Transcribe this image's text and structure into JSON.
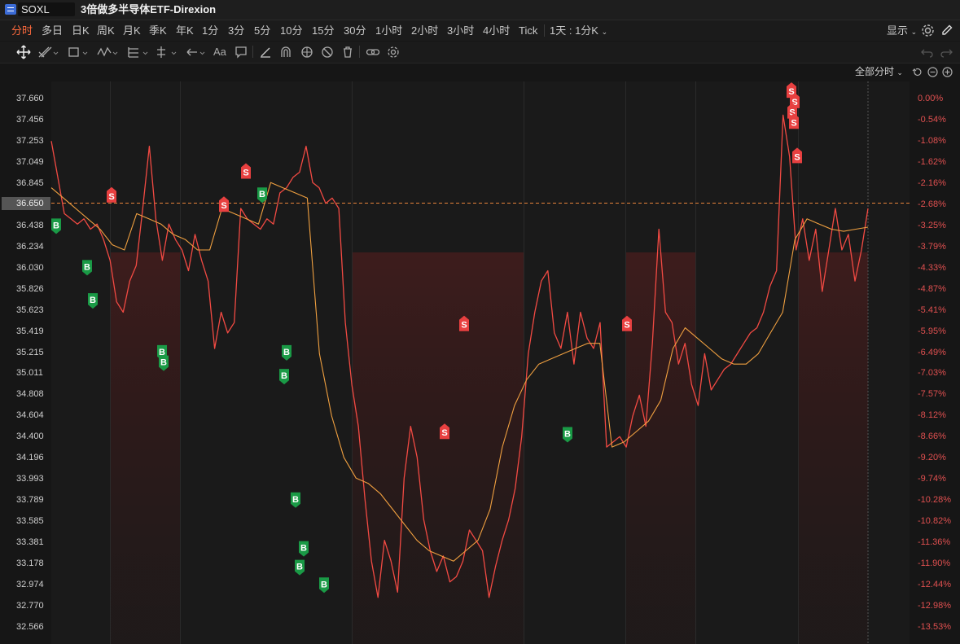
{
  "window": {
    "symbol": "SOXL",
    "name": "3倍做多半导体ETF-Direxion"
  },
  "periods": [
    "分时",
    "多日",
    "日K",
    "周K",
    "月K",
    "季K",
    "年K",
    "1分",
    "3分",
    "5分",
    "10分",
    "15分",
    "30分",
    "1小时",
    "2小时",
    "3小时",
    "4小时",
    "Tick"
  ],
  "active_period": "分时",
  "multi_period": "1天 : 1分K",
  "display_label": "显示",
  "range_label": "全部分时",
  "price_axis": [
    "37.660",
    "37.456",
    "37.253",
    "37.049",
    "36.845",
    "36.650",
    "36.438",
    "36.234",
    "36.030",
    "35.826",
    "35.623",
    "35.419",
    "35.215",
    "35.011",
    "34.808",
    "34.604",
    "34.400",
    "34.196",
    "33.993",
    "33.789",
    "33.585",
    "33.381",
    "33.178",
    "32.974",
    "32.770",
    "32.566"
  ],
  "pct_axis": [
    "0.00%",
    "-0.54%",
    "-1.08%",
    "-1.62%",
    "-2.16%",
    "-2.68%",
    "-3.25%",
    "-3.79%",
    "-4.33%",
    "-4.87%",
    "-5.41%",
    "-5.95%",
    "-6.49%",
    "-7.03%",
    "-7.57%",
    "-8.12%",
    "-8.66%",
    "-9.20%",
    "-9.74%",
    "-10.28%",
    "-10.82%",
    "-11.36%",
    "-11.90%",
    "-12.44%",
    "-12.98%",
    "-13.53%"
  ],
  "current_price": "36.650",
  "colors": {
    "price_line": "#f24a43",
    "avg_line": "#f0a040",
    "buy": "#1a9a46",
    "sell": "#e84040",
    "active_tab": "#ff6a3d"
  },
  "chart_data": {
    "type": "line",
    "title": "",
    "xlabel": "",
    "ylabel": "",
    "ylim": [
      32.566,
      37.66
    ],
    "reference_price": 36.65,
    "series": [
      {
        "name": "",
        "values": [
          37.25,
          36.9,
          36.55,
          36.5,
          36.45,
          36.5,
          36.4,
          36.45,
          36.3,
          36.1,
          35.7,
          35.6,
          35.9,
          36.05,
          36.6,
          37.2,
          36.5,
          36.1,
          36.45,
          36.3,
          36.2,
          36.0,
          36.35,
          36.1,
          35.9,
          35.25,
          35.6,
          35.4,
          35.5,
          36.6,
          36.5,
          36.45,
          36.4,
          36.5,
          36.45,
          36.75,
          36.8,
          36.9,
          36.95,
          37.2,
          36.85,
          36.8,
          36.65,
          36.7,
          36.6,
          35.5,
          34.9,
          34.5,
          33.8,
          33.2,
          32.85,
          33.4,
          33.2,
          32.9,
          34.0,
          34.5,
          34.2,
          33.6,
          33.3,
          33.1,
          33.25,
          33.0,
          33.05,
          33.2,
          33.5,
          33.4,
          33.3,
          32.85,
          33.15,
          33.4,
          33.6,
          33.9,
          34.4,
          35.2,
          35.6,
          35.9,
          36.0,
          35.4,
          35.25,
          35.6,
          35.1,
          35.6,
          35.35,
          35.25,
          35.5,
          34.3,
          34.35,
          34.4,
          34.3,
          34.6,
          34.8,
          34.5,
          35.3,
          36.4,
          35.6,
          35.5,
          35.1,
          35.3,
          34.9,
          34.7,
          35.2,
          34.85,
          34.95,
          35.05,
          35.1,
          35.2,
          35.3,
          35.4,
          35.45,
          35.6,
          35.85,
          36.0,
          37.5,
          37.1,
          36.2,
          36.5,
          36.1,
          36.4,
          35.8,
          36.2,
          36.6,
          36.2,
          36.35,
          35.9,
          36.2,
          36.6
        ]
      },
      {
        "name": "",
        "values": [
          36.8,
          36.7,
          36.6,
          36.5,
          36.4,
          36.25,
          36.2,
          36.55,
          36.5,
          36.45,
          36.35,
          36.3,
          36.2,
          36.2,
          36.6,
          36.55,
          36.5,
          36.45,
          36.85,
          36.8,
          36.75,
          36.7,
          35.2,
          34.6,
          34.2,
          34.0,
          33.95,
          33.85,
          33.7,
          33.55,
          33.4,
          33.3,
          33.25,
          33.2,
          33.3,
          33.4,
          33.7,
          34.3,
          34.7,
          34.95,
          35.1,
          35.15,
          35.2,
          35.25,
          35.3,
          35.3,
          34.3,
          34.35,
          34.45,
          34.55,
          34.75,
          35.25,
          35.45,
          35.35,
          35.25,
          35.15,
          35.1,
          35.1,
          35.2,
          35.4,
          35.6,
          36.3,
          36.5,
          36.45,
          36.4,
          36.38,
          36.4,
          36.42
        ]
      }
    ],
    "markers": [
      {
        "type": "B",
        "label": "B",
        "price": 36.44
      },
      {
        "type": "B",
        "label": "B",
        "price": 36.04
      },
      {
        "type": "B",
        "label": "B",
        "price": 35.72
      },
      {
        "type": "S",
        "label": "S",
        "price": 36.72
      },
      {
        "type": "B",
        "label": "B",
        "price": 35.22
      },
      {
        "type": "B",
        "label": "B",
        "price": 35.12
      },
      {
        "type": "S",
        "label": "S",
        "price": 36.63
      },
      {
        "type": "S",
        "label": "S",
        "price": 36.95
      },
      {
        "type": "B",
        "label": "B",
        "price": 36.74
      },
      {
        "type": "B",
        "label": "B",
        "price": 35.22
      },
      {
        "type": "B",
        "label": "B",
        "price": 34.99
      },
      {
        "type": "B",
        "label": "B",
        "price": 33.8
      },
      {
        "type": "B",
        "label": "B",
        "price": 33.33
      },
      {
        "type": "B",
        "label": "B",
        "price": 33.15
      },
      {
        "type": "B",
        "label": "B",
        "price": 32.98
      },
      {
        "type": "S",
        "label": "S",
        "price": 34.44
      },
      {
        "type": "S",
        "label": "S",
        "price": 35.48
      },
      {
        "type": "B",
        "label": "B",
        "price": 34.43
      },
      {
        "type": "S",
        "label": "S",
        "price": 35.48
      },
      {
        "type": "S",
        "label": "S",
        "price": 37.73
      },
      {
        "type": "S",
        "label": "S",
        "price": 37.63
      },
      {
        "type": "S",
        "label": "S",
        "price": 37.53
      },
      {
        "type": "S",
        "label": "S",
        "price": 37.43
      },
      {
        "type": "S",
        "label": "S",
        "price": 37.1
      }
    ]
  }
}
